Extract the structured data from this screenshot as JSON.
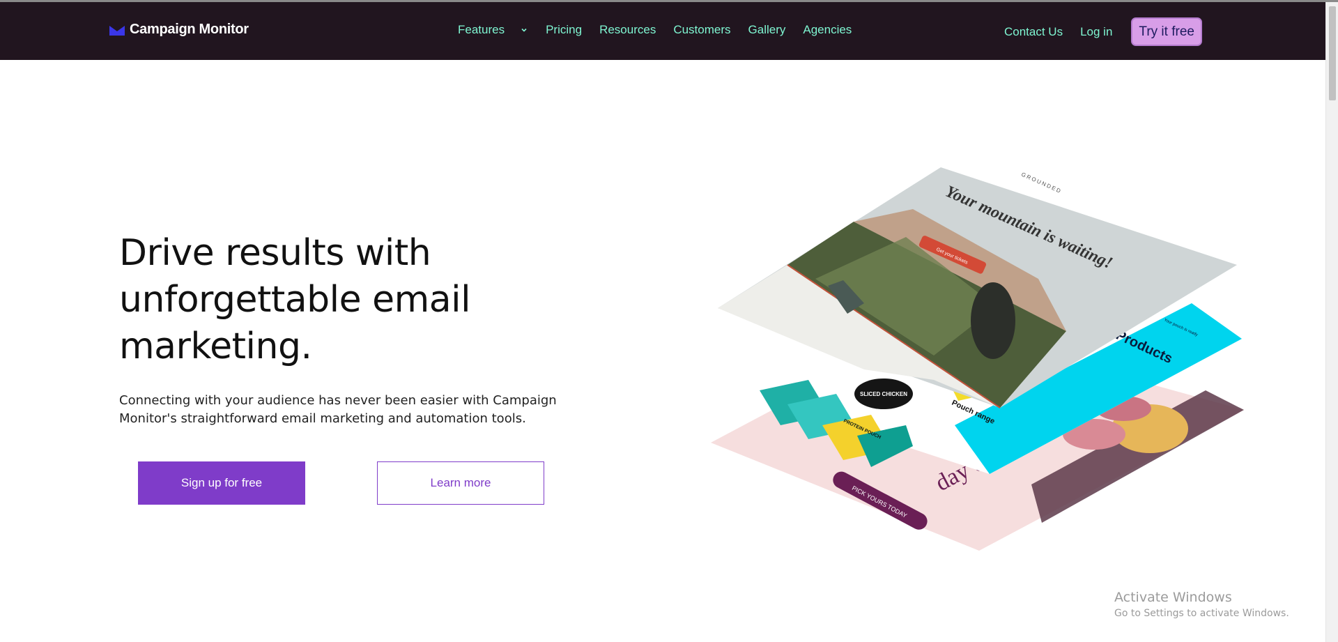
{
  "brand": {
    "name": "Campaign Monitor",
    "accent": "#7f3cc9",
    "nav_bg": "#21151f",
    "link_color": "#7ff6d2"
  },
  "nav": {
    "items": [
      {
        "label": "Features"
      },
      {
        "label": "Pricing"
      },
      {
        "label": "Resources"
      },
      {
        "label": "Customers"
      },
      {
        "label": "Gallery"
      },
      {
        "label": "Agencies"
      }
    ],
    "contact_label": "Contact Us",
    "login_label": "Log in",
    "cta_label": "Try it free"
  },
  "hero": {
    "title": "Drive results with unforgettable email marketing.",
    "subtitle": "Connecting with your audience has never been easier with Campaign Monitor's straightforward email marketing and automation tools.",
    "primary_cta": "Sign up for free",
    "secondary_cta": "Learn more"
  },
  "illustration": {
    "card_top": {
      "brand": "GROUNDED",
      "headline": "Your mountain is waiting!",
      "button": "Get your tickets"
    },
    "card_middle": {
      "headline": "Products",
      "small_label": "Your pouch is ready",
      "badge": "SLICED CHICKEN",
      "pouch": "PROTEIN POUCH",
      "caption": "Pouch range"
    },
    "card_bottom": {
      "headline": "day er.",
      "button": "PICK YOURS TODAY"
    }
  },
  "watermark": {
    "title": "Activate Windows",
    "subtitle": "Go to Settings to activate Windows."
  }
}
